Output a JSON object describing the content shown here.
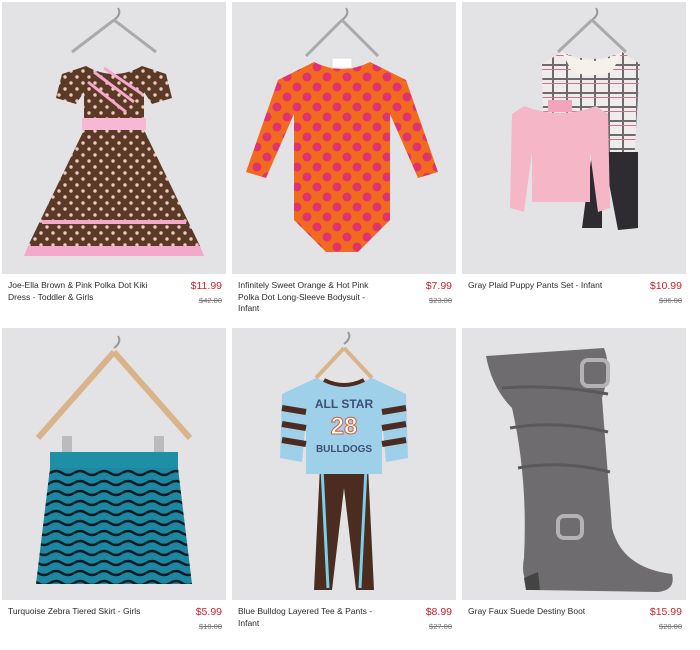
{
  "products": [
    {
      "name": "Joe-Ella Brown & Pink Polka Dot Kiki Dress - Toddler & Girls",
      "price": "$11.99",
      "was": "$42.00",
      "image": "brown-pink-polka-dot-dress"
    },
    {
      "name": "Infinitely Sweet Orange & Hot Pink Polka Dot Long-Sleeve Bodysuit - Infant",
      "price": "$7.99",
      "was": "$23.00",
      "image": "orange-pink-polka-dot-bodysuit"
    },
    {
      "name": "Gray Plaid Puppy Pants Set - Infant",
      "price": "$10.99",
      "was": "$36.00",
      "image": "plaid-cardigan-pants-set"
    },
    {
      "name": "Turquoise Zebra Tiered Skirt - Girls",
      "price": "$5.99",
      "was": "$10.00",
      "image": "turquoise-zebra-skirt"
    },
    {
      "name": "Blue Bulldog Layered Tee & Pants - Infant",
      "price": "$8.99",
      "was": "$27.00",
      "image": "blue-bulldog-tee-pants"
    },
    {
      "name": "Gray Faux Suede Destiny Boot",
      "price": "$15.99",
      "was": "$28.00",
      "image": "gray-suede-boot"
    }
  ],
  "shirt_print": {
    "line1": "ALL STAR",
    "number": "28",
    "line2": "BULLDOGS"
  },
  "colors": {
    "price": "#c8232c",
    "thumb_bg": "#e3e3e5"
  }
}
